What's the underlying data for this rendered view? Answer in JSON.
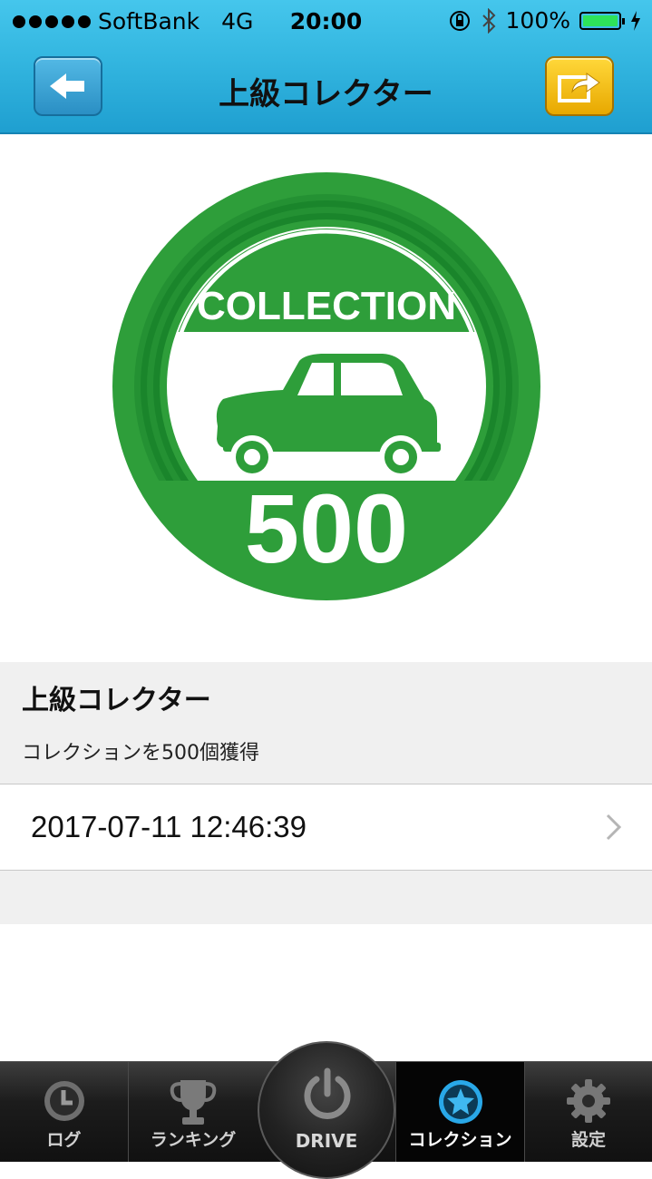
{
  "status_bar": {
    "carrier": "SoftBank",
    "network": "4G",
    "time": "20:00",
    "battery": "100%"
  },
  "header": {
    "title": "上級コレクター",
    "back_icon": "back-arrow-icon",
    "share_icon": "share-icon"
  },
  "badge": {
    "top_text": "COLLECTION",
    "number": "500",
    "icon": "car-icon",
    "color": "#2e9e3a"
  },
  "detail": {
    "title": "上級コレクター",
    "description": "コレクションを500個獲得"
  },
  "acquired_at": "2017-07-11 12:46:39",
  "tabbar": {
    "tabs": [
      {
        "label": "ログ",
        "icon": "clock-icon"
      },
      {
        "label": "ランキング",
        "icon": "trophy-icon"
      },
      {
        "label": "DRIVE",
        "icon": "power-icon"
      },
      {
        "label": "コレクション",
        "icon": "star-icon",
        "active": true
      },
      {
        "label": "設定",
        "icon": "gear-icon"
      }
    ]
  },
  "colors": {
    "header_blue": "#33b6e0",
    "badge_green": "#2e9e3a",
    "share_yellow": "#f5c300",
    "active_tab_icon": "#29a8e8"
  }
}
